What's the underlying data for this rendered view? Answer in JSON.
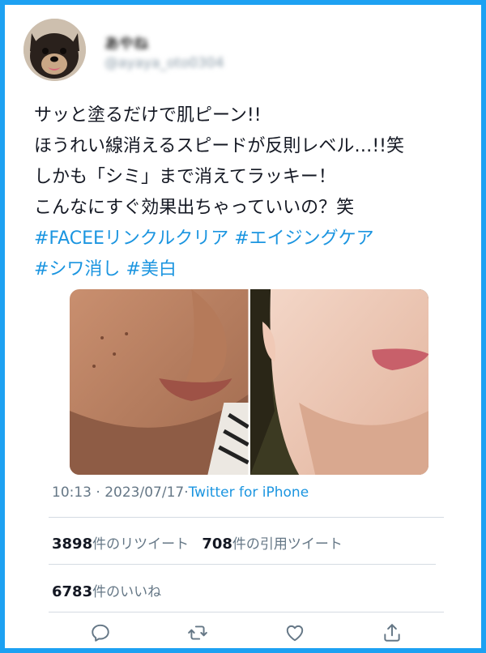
{
  "user": {
    "display_name": "あやね",
    "handle": "@ayaya_oto0304"
  },
  "tweet": {
    "lines": [
      "サッと塗るだけで肌ピーン!!",
      "ほうれい線消えるスピードが反則レベル…!!笑",
      "しかも「シミ」まで消えてラッキー！",
      "こんなにすぐ効果出ちゃっていいの？笑"
    ],
    "hashtags_line1": [
      "#FACEEリンクルクリア",
      "#エイジングケア"
    ],
    "hashtags_line2": [
      "#シワ消し",
      "#美白"
    ]
  },
  "meta": {
    "time": "10:13",
    "separator1": " · ",
    "date": "2023/07/17",
    "separator2": "·",
    "source": "Twitter for iPhone"
  },
  "stats": {
    "retweets_count": "3898",
    "retweets_label": "件のリツイート",
    "quotes_count": "708",
    "quotes_label": "件の引用ツイート",
    "likes_count": "6783",
    "likes_label": "件のいいね"
  },
  "actions": [
    {
      "icon": "reply-icon"
    },
    {
      "icon": "retweet-icon"
    },
    {
      "icon": "like-icon"
    },
    {
      "icon": "share-icon"
    }
  ],
  "colors": {
    "accent": "#1da1f2",
    "link": "#1b95e0",
    "muted": "#657786"
  }
}
